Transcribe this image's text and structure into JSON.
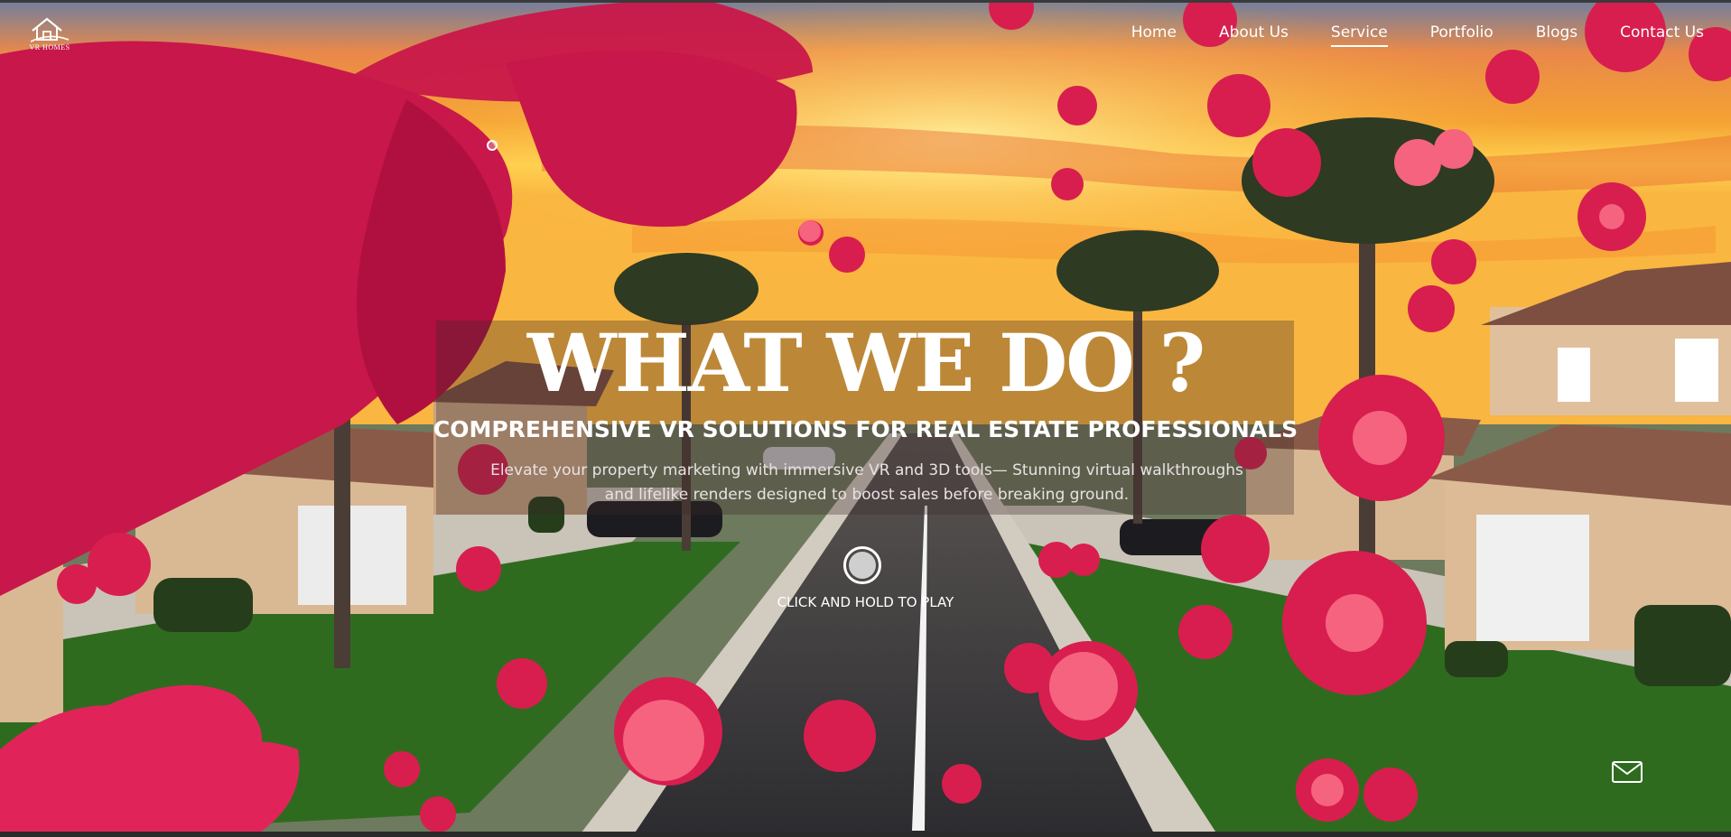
{
  "brand": {
    "logo_text": "VR HOMES"
  },
  "nav": {
    "items": [
      {
        "label": "Home",
        "active": false
      },
      {
        "label": "About Us",
        "active": false
      },
      {
        "label": "Service",
        "active": true
      },
      {
        "label": "Portfolio",
        "active": false
      },
      {
        "label": "Blogs",
        "active": false
      },
      {
        "label": "Contact Us",
        "active": false
      }
    ]
  },
  "hero": {
    "headline": "WHAT WE DO ?",
    "subheadline": "COMPREHENSIVE VR SOLUTIONS FOR REAL ESTATE PROFESSIONALS",
    "description_line1": "Elevate your property marketing with immersive VR and 3D tools— Stunning virtual walkthroughs",
    "description_line2": "and lifelike renders designed to boost sales before breaking ground.",
    "play_label": "CLICK AND HOLD TO PLAY"
  },
  "icons": {
    "logo": "house-logo-icon",
    "play": "play-button-icon",
    "mail": "mail-icon",
    "cursor": "cursor-dot-icon"
  },
  "colors": {
    "sky_top": "#f08a2a",
    "sky_glow": "#ffd24a",
    "petal": "#d81e4e",
    "petal_light": "#f2557a",
    "grass": "#2f6b1f",
    "road": "#3a3a3e",
    "house": "#d9b994",
    "roof": "#8a5a48"
  }
}
